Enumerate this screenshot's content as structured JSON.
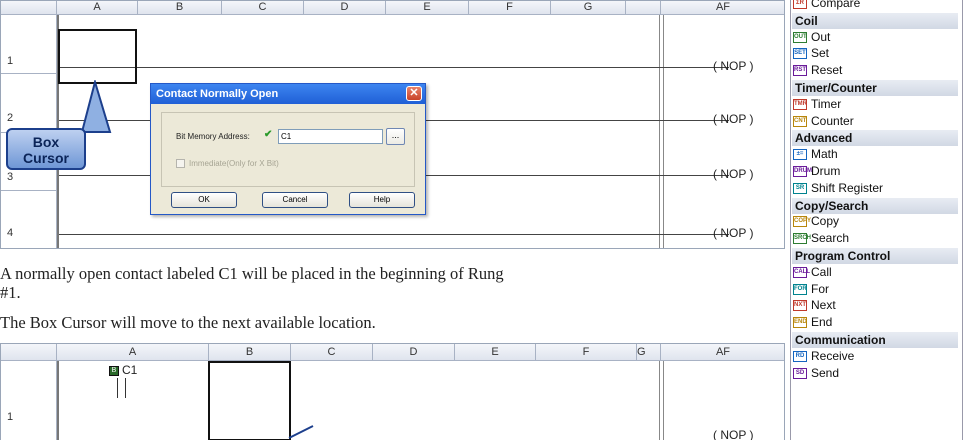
{
  "top_grid": {
    "columns": [
      "A",
      "B",
      "C",
      "D",
      "E",
      "F",
      "G",
      "AF"
    ],
    "rows": [
      "1",
      "2",
      "3",
      "4"
    ],
    "nop_label": "( NOP )"
  },
  "dialog": {
    "title": "Contact Normally Open",
    "bit_label": "Bit Memory Address:",
    "bit_value": "C1",
    "browse_label": "...",
    "immediate_label": "Immediate(Only for X Bit)",
    "ok": "OK",
    "cancel": "Cancel",
    "help": "Help"
  },
  "callout": {
    "line1": "Box",
    "line2": "Cursor"
  },
  "text": {
    "para1_line1": "A normally open contact labeled C1 will be placed in the beginning of Rung",
    "para1_line2": "#1.",
    "para2": "The Box Cursor will move to the next available location."
  },
  "bottom_grid": {
    "columns": [
      "A",
      "B",
      "C",
      "D",
      "E",
      "F",
      "G",
      "AF"
    ],
    "row": "1",
    "contact_label": "C1",
    "nop_label": "( NOP )"
  },
  "palette": {
    "items": [
      {
        "type": "item",
        "icon": "ΣR",
        "label": "Compare"
      },
      {
        "type": "cat",
        "label": "Coil"
      },
      {
        "type": "item",
        "icon": "OUT",
        "label": "Out"
      },
      {
        "type": "item",
        "icon": "SET",
        "label": "Set"
      },
      {
        "type": "item",
        "icon": "RST",
        "label": "Reset"
      },
      {
        "type": "cat",
        "label": "Timer/Counter"
      },
      {
        "type": "item",
        "icon": "TMR",
        "label": "Timer"
      },
      {
        "type": "item",
        "icon": "CNT",
        "label": "Counter"
      },
      {
        "type": "cat",
        "label": "Advanced"
      },
      {
        "type": "item",
        "icon": "±=",
        "label": "Math"
      },
      {
        "type": "item",
        "icon": "DRUM",
        "label": "Drum"
      },
      {
        "type": "item",
        "icon": "SR",
        "label": "Shift Register"
      },
      {
        "type": "cat",
        "label": "Copy/Search"
      },
      {
        "type": "item",
        "icon": "COPY",
        "label": "Copy"
      },
      {
        "type": "item",
        "icon": "SRCH",
        "label": "Search"
      },
      {
        "type": "cat",
        "label": "Program Control"
      },
      {
        "type": "item",
        "icon": "CALL",
        "label": "Call"
      },
      {
        "type": "item",
        "icon": "FOR",
        "label": "For"
      },
      {
        "type": "item",
        "icon": "NXT",
        "label": "Next"
      },
      {
        "type": "item",
        "icon": "END",
        "label": "End"
      },
      {
        "type": "cat",
        "label": "Communication"
      },
      {
        "type": "item",
        "icon": "RD",
        "label": "Receive"
      },
      {
        "type": "item",
        "icon": "SD",
        "label": "Send"
      }
    ]
  }
}
